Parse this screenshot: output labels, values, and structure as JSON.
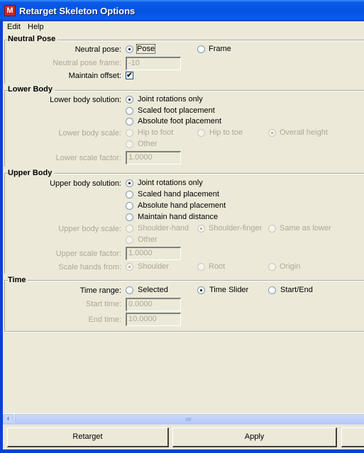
{
  "window": {
    "title": "Retarget Skeleton Options",
    "app_icon": "maya-app-icon"
  },
  "menubar": {
    "items": [
      "Edit",
      "Help"
    ]
  },
  "sections": {
    "neutral_pose": {
      "title": "Neutral Pose",
      "neutral_pose_label": "Neutral pose:",
      "options": [
        {
          "label": "Pose",
          "selected": true
        },
        {
          "label": "Frame",
          "selected": false
        }
      ],
      "neutral_pose_frame_label": "Neutral pose frame:",
      "neutral_pose_frame_value": "-10",
      "maintain_offset_label": "Maintain offset:",
      "maintain_offset_checked": true,
      "check_glyph": "✔"
    },
    "lower_body": {
      "title": "Lower Body",
      "solution_label": "Lower body solution:",
      "solutions": [
        {
          "label": "Joint rotations only",
          "selected": true
        },
        {
          "label": "Scaled foot placement",
          "selected": false
        },
        {
          "label": "Absolute foot placement",
          "selected": false
        }
      ],
      "scale_label": "Lower body scale:",
      "scales": [
        {
          "label": "Hip to foot",
          "selected": false
        },
        {
          "label": "Hip to toe",
          "selected": false
        },
        {
          "label": "Overall height",
          "selected": true
        },
        {
          "label": "Other",
          "selected": false
        }
      ],
      "scale_factor_label": "Lower scale factor:",
      "scale_factor_value": "1.0000"
    },
    "upper_body": {
      "title": "Upper Body",
      "solution_label": "Upper body solution:",
      "solutions": [
        {
          "label": "Joint rotations only",
          "selected": true
        },
        {
          "label": "Scaled hand placement",
          "selected": false
        },
        {
          "label": "Absolute hand placement",
          "selected": false
        },
        {
          "label": "Maintain hand distance",
          "selected": false
        }
      ],
      "scale_label": "Upper body scale:",
      "scales": [
        {
          "label": "Shoulder-hand",
          "selected": false
        },
        {
          "label": "Shoulder-finger",
          "selected": true
        },
        {
          "label": "Same as lower",
          "selected": false
        },
        {
          "label": "Other",
          "selected": false
        }
      ],
      "scale_factor_label": "Upper scale factor:",
      "scale_factor_value": "1.0000",
      "scale_hands_label": "Scale hands from:",
      "scale_hands": [
        {
          "label": "Shoulder",
          "selected": true
        },
        {
          "label": "Root",
          "selected": false
        },
        {
          "label": "Origin",
          "selected": false
        }
      ]
    },
    "time": {
      "title": "Time",
      "range_label": "Time range:",
      "ranges": [
        {
          "label": "Selected",
          "selected": false
        },
        {
          "label": "Time Slider",
          "selected": true
        },
        {
          "label": "Start/End",
          "selected": false
        }
      ],
      "start_label": "Start time:",
      "start_value": "0.0000",
      "end_label": "End time:",
      "end_value": "10.0000"
    }
  },
  "scrollbar": {
    "left_arrow": "‹"
  },
  "buttons": {
    "retarget": "Retarget",
    "apply": "Apply"
  }
}
